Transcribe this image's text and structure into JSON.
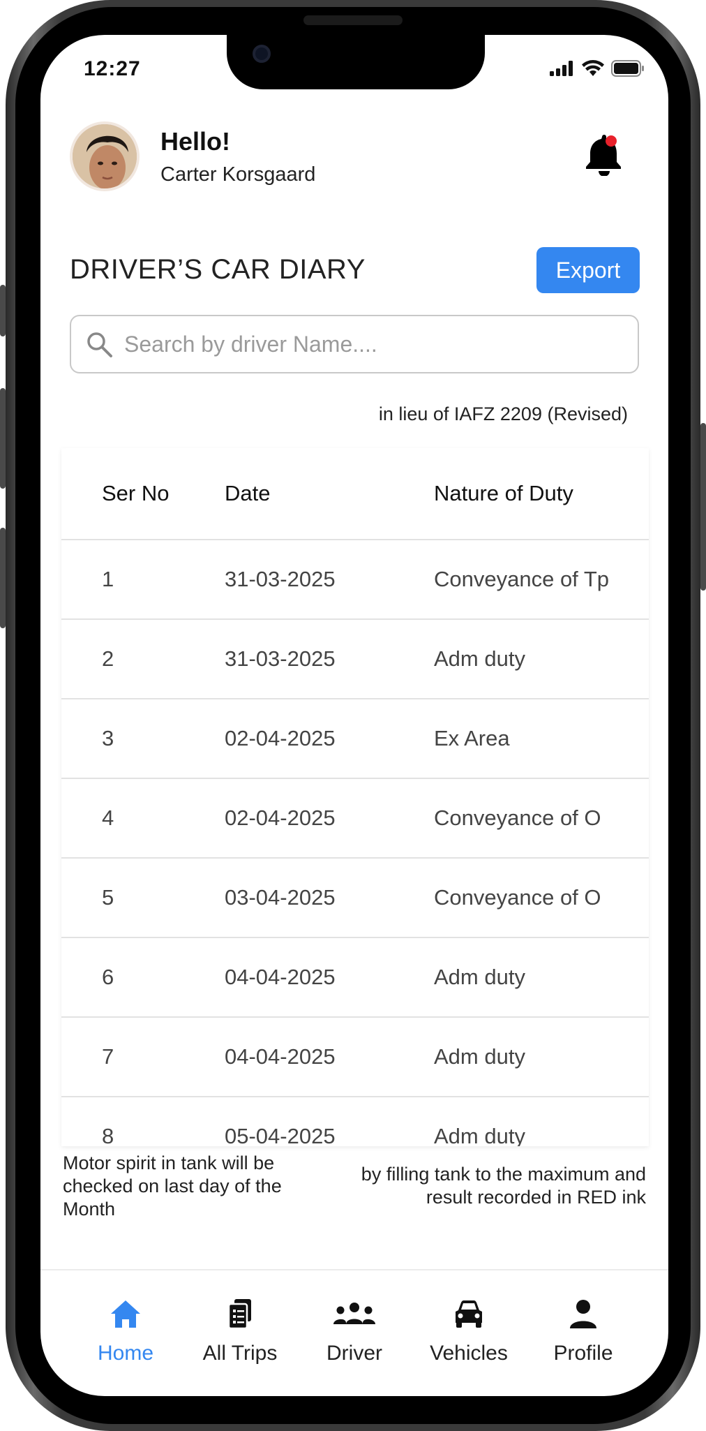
{
  "status": {
    "time": "12:27"
  },
  "header": {
    "greeting": "Hello!",
    "user_name": "Carter Korsgaard"
  },
  "page": {
    "title": "DRIVER’S CAR DIARY",
    "export_label": "Export"
  },
  "search": {
    "placeholder": "Search by driver Name...."
  },
  "subtitle": "in lieu of IAFZ 2209 (Revised)",
  "table": {
    "columns": [
      "Ser No",
      "Date",
      "Nature of Duty"
    ],
    "rows": [
      {
        "ser": "1",
        "date": "31-03-2025",
        "duty": "Conveyance of Tp"
      },
      {
        "ser": "2",
        "date": "31-03-2025",
        "duty": "Adm duty"
      },
      {
        "ser": "3",
        "date": "02-04-2025",
        "duty": "Ex Area"
      },
      {
        "ser": "4",
        "date": "02-04-2025",
        "duty": "Conveyance of O"
      },
      {
        "ser": "5",
        "date": "03-04-2025",
        "duty": "Conveyance of O"
      },
      {
        "ser": "6",
        "date": "04-04-2025",
        "duty": "Adm duty"
      },
      {
        "ser": "7",
        "date": "04-04-2025",
        "duty": "Adm duty"
      },
      {
        "ser": "8",
        "date": "05-04-2025",
        "duty": "Adm duty"
      }
    ]
  },
  "notes": {
    "left": "Motor spirit in tank will be checked on last day of the Month",
    "right": "by filling tank to the maximum and result recorded in RED ink"
  },
  "tabbar": {
    "items": [
      {
        "label": "Home",
        "icon": "home-icon",
        "active": true
      },
      {
        "label": "All Trips",
        "icon": "trips-icon",
        "active": false
      },
      {
        "label": "Driver",
        "icon": "driver-group-icon",
        "active": false
      },
      {
        "label": "Vehicles",
        "icon": "car-icon",
        "active": false
      },
      {
        "label": "Profile",
        "icon": "profile-icon",
        "active": false
      }
    ]
  },
  "colors": {
    "accent": "#3487f0",
    "notification_dot": "#e8212b"
  }
}
